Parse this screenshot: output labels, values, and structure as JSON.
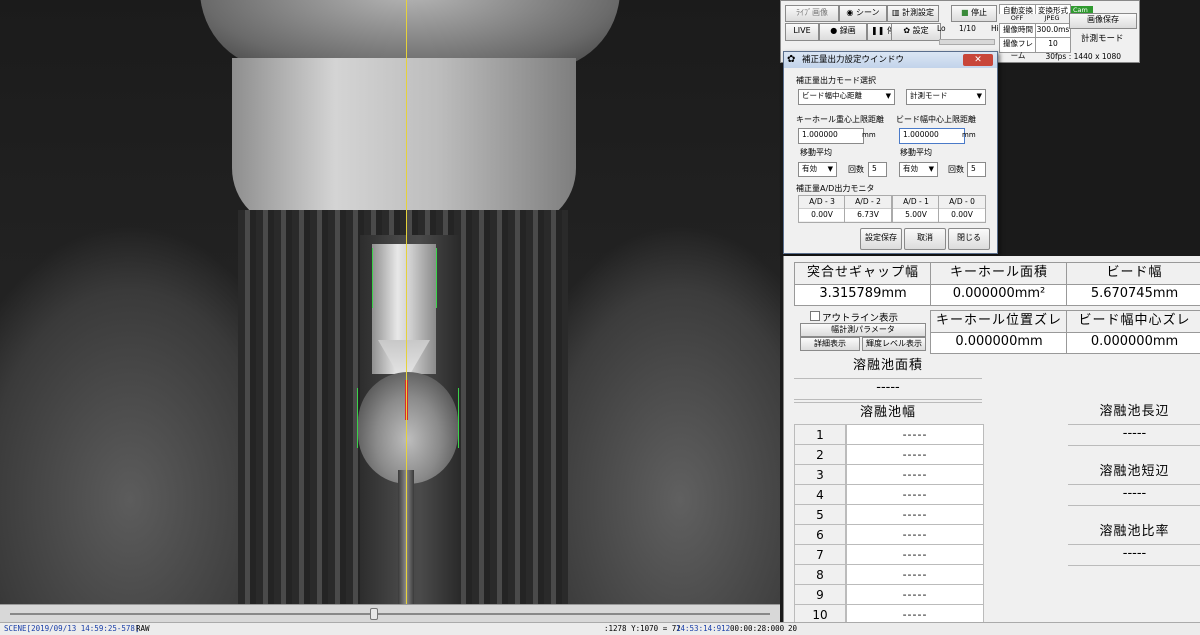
{
  "toolbar": {
    "tab_live_image": "ﾗｲﾌﾞ画像",
    "tab_scene": "シーン",
    "tab_measure_settings": "計測設定",
    "stop_label_top": "停止",
    "live_button": "LIVE",
    "record_button": "録画",
    "stop_button": "停止",
    "settings_button": "設定",
    "lo_label": "Lo",
    "ratio_value": "1/10",
    "hi_label": "Hi",
    "auto_convert_label": "自動変換",
    "auto_convert_value": "OFF",
    "convert_format_label": "変換形式",
    "convert_format_value": "JPEG",
    "cam_label": "Cam",
    "capture_time_label": "撮像時間",
    "capture_time_value": "300.0ms",
    "capture_frames_label": "撮像フレーム",
    "capture_frames_value": "10",
    "save_image_button": "画像保存",
    "mode_label": "計測モード",
    "fps_info": "30fps : 1440 x 1080"
  },
  "dialog": {
    "title": "補正量出力設定ウインドウ",
    "close": "✕",
    "mode_select_label": "補正量出力モード選択",
    "mode_select_value": "ビード幅中心距離",
    "measure_mode_value": "計測モード",
    "keyhole_limit_label": "キーホール重心上限距離",
    "keyhole_limit_value": "1.000000",
    "keyhole_unit": "mm",
    "bead_limit_label": "ビード幅中心上限距離",
    "bead_limit_value": "1.000000",
    "bead_unit": "mm",
    "moving_avg_label_1": "移動平均",
    "moving_avg_label_2": "移動平均",
    "enabled_value_1": "有効",
    "enabled_value_2": "有効",
    "count_label_1": "回数",
    "count_value_1": "5",
    "count_label_2": "回数",
    "count_value_2": "5",
    "ad_monitor_label": "補正量A/D出力モニタ",
    "ad_channels": [
      {
        "name": "A/D - 3",
        "value": "0.00V"
      },
      {
        "name": "A/D - 2",
        "value": "6.73V"
      },
      {
        "name": "A/D - 1",
        "value": "5.00V"
      },
      {
        "name": "A/D - 0",
        "value": "0.00V"
      }
    ],
    "save_button": "設定保存",
    "cancel_button": "取消",
    "close_button": "閉じる"
  },
  "results": {
    "gap_width_label": "突合せギャップ幅",
    "gap_width_value": "3.315789mm",
    "keyhole_area_label": "キーホール面積",
    "keyhole_area_value": "0.000000mm²",
    "bead_width_label": "ビード幅",
    "bead_width_value": "5.670745mm",
    "outline_checkbox_label": "アウトライン表示",
    "width_param_button": "幅計測パラメータ",
    "detail_button": "詳細表示",
    "brightness_button": "輝度レベル表示",
    "keyhole_offset_label": "キーホール位置ズレ",
    "keyhole_offset_value": "0.000000mm",
    "bead_center_offset_label": "ビード幅中心ズレ",
    "bead_center_offset_value": "0.000000mm",
    "pool_area_label": "溶融池面積",
    "pool_area_value": "-----",
    "pool_width_label": "溶融池幅",
    "pool_width_rows": [
      {
        "n": "1",
        "v": "-----"
      },
      {
        "n": "2",
        "v": "-----"
      },
      {
        "n": "3",
        "v": "-----"
      },
      {
        "n": "4",
        "v": "-----"
      },
      {
        "n": "5",
        "v": "-----"
      },
      {
        "n": "6",
        "v": "-----"
      },
      {
        "n": "7",
        "v": "-----"
      },
      {
        "n": "8",
        "v": "-----"
      },
      {
        "n": "9",
        "v": "-----"
      },
      {
        "n": "10",
        "v": "-----"
      }
    ],
    "pool_long_label": "溶融池長辺",
    "pool_long_value": "-----",
    "pool_short_label": "溶融池短辺",
    "pool_short_value": "-----",
    "pool_ratio_label": "溶融池比率",
    "pool_ratio_value": "-----"
  },
  "statusbar": {
    "scene": "SCENE[2019/09/13 14:59:25-578]",
    "raw": "RAW",
    "coords": ":1278 Y:1070 = 72",
    "time": "14:53:14:912",
    "elapsed": "00:00:28:000",
    "extra": "20"
  }
}
